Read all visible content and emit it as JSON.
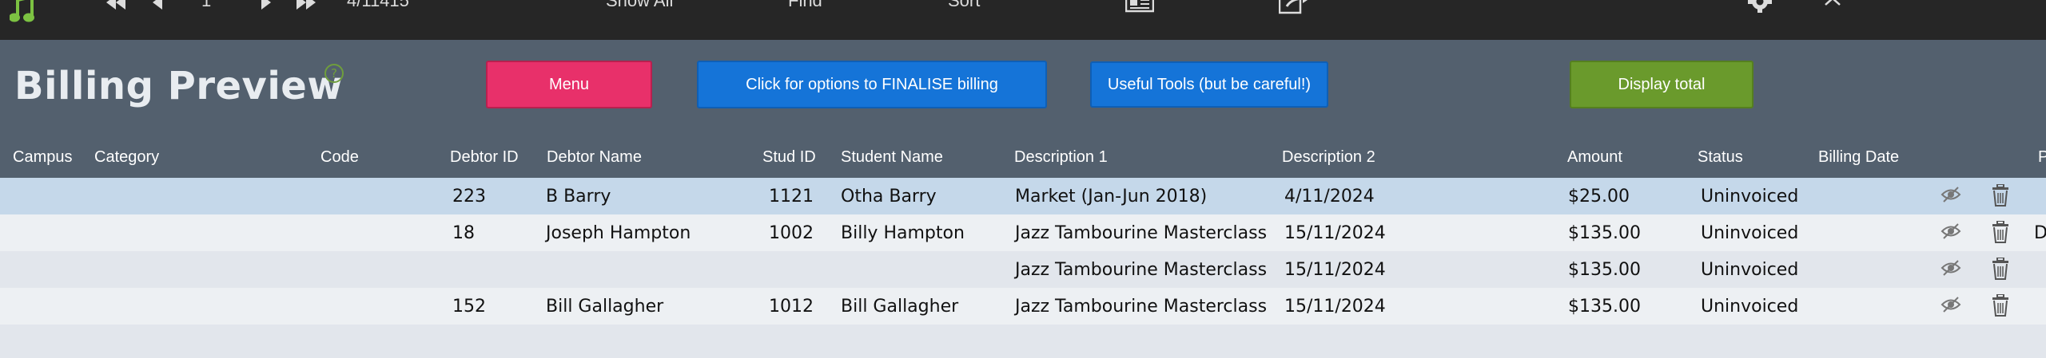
{
  "toolbar": {
    "record_current": "1",
    "record_total": "4/11415",
    "show_all": "Show All",
    "find": "Find",
    "sort": "Sort"
  },
  "page": {
    "title": "Billing Preview",
    "help": "?"
  },
  "buttons": {
    "menu": "Menu",
    "finalise": "Click for options to FINALISE billing",
    "tools": "Useful Tools (but be careful!)",
    "total": "Display total"
  },
  "columns": {
    "campus": "Campus",
    "category": "Category",
    "code": "Code",
    "debtor_id": "Debtor ID",
    "debtor_name": "Debtor Name",
    "stud_id": "Stud ID",
    "student_name": "Student Name",
    "desc1": "Description 1",
    "desc2": "Description 2",
    "amount": "Amount",
    "status": "Status",
    "billing_date": "Billing Date",
    "extra": "P"
  },
  "rows": [
    {
      "debtor_id": "223",
      "debtor_name": "B Barry",
      "stud_id": "1121",
      "student_name": "Otha Barry",
      "desc1": "Market (Jan-Jun 2018)",
      "desc2": "4/11/2024",
      "amount": "$25.00",
      "status": "Uninvoiced",
      "extra": ""
    },
    {
      "debtor_id": "18",
      "debtor_name": "Joseph Hampton",
      "stud_id": "1002",
      "student_name": "Billy Hampton",
      "desc1": "Jazz Tambourine Masterclass",
      "desc2": "15/11/2024",
      "amount": "$135.00",
      "status": "Uninvoiced",
      "extra": "D"
    },
    {
      "debtor_id": "",
      "debtor_name": "",
      "stud_id": "",
      "student_name": "",
      "desc1": "Jazz Tambourine Masterclass",
      "desc2": "15/11/2024",
      "amount": "$135.00",
      "status": "Uninvoiced",
      "extra": ""
    },
    {
      "debtor_id": "152",
      "debtor_name": "Bill Gallagher",
      "stud_id": "1012",
      "student_name": "Bill Gallagher",
      "desc1": "Jazz Tambourine Masterclass",
      "desc2": "15/11/2024",
      "amount": "$135.00",
      "status": "Uninvoiced",
      "extra": ""
    }
  ],
  "colors": {
    "menu": "#e8306a",
    "primary": "#1574d8",
    "success": "#6a9a2c",
    "header_bg": "#53606e",
    "toolbar_bg": "#262626",
    "selected_row": "#c5d8ea"
  },
  "icons": [
    "music-note-icon",
    "first-record-icon",
    "prev-record-icon",
    "next-record-icon",
    "last-record-icon",
    "contact-card-icon",
    "share-icon",
    "gear-icon",
    "close-icon",
    "hide-icon",
    "trash-icon"
  ]
}
